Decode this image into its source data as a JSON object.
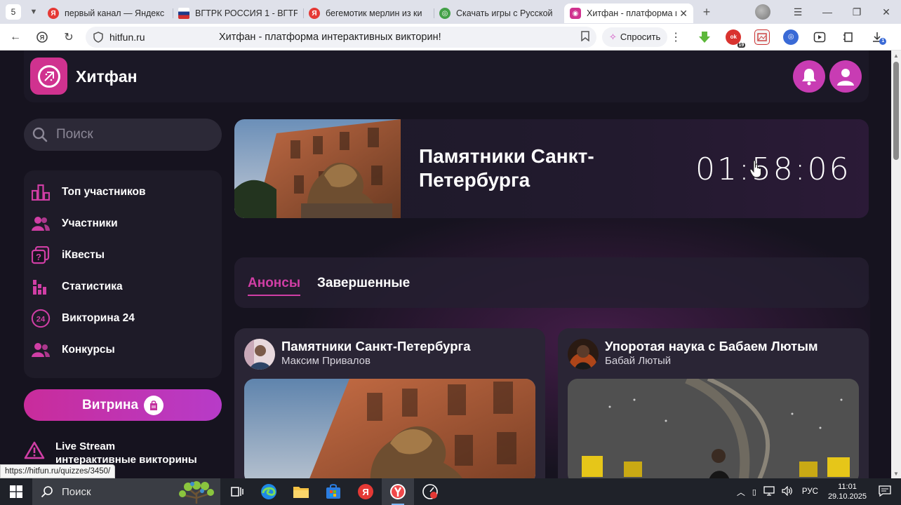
{
  "browser": {
    "tab_count": "5",
    "tabs": [
      {
        "title": "первый канал — Яндекс",
        "favicon": "yandex-icon",
        "color": "#e53935"
      },
      {
        "title": "ВГТРК РОССИЯ 1 - ВГТР",
        "favicon": "flag-icon",
        "color": "#1e3a8a"
      },
      {
        "title": "бегемотик мерлин из ки",
        "favicon": "yandex-icon",
        "color": "#e53935"
      },
      {
        "title": "Скачать игры с Русской",
        "favicon": "globe-icon",
        "color": "#43a047"
      },
      {
        "title": "Хитфан - платформа и",
        "favicon": "hitfun-icon",
        "color": "#d0328f"
      }
    ],
    "url": "hitfun.ru",
    "page_title": "Хитфан - платформа интерактивных викторин!",
    "ask_label": "Спросить",
    "status_url": "https://hitfun.ru/quizzes/3450/",
    "ext_badge": "19"
  },
  "site": {
    "logo_text": "Хитфан",
    "accent": "#d0328f",
    "search_placeholder": "Поиск",
    "nav": [
      {
        "label": "Топ участников",
        "icon": "bar-chart-icon"
      },
      {
        "label": "Участники",
        "icon": "users-icon"
      },
      {
        "label": "iКвесты",
        "icon": "quest-icon"
      },
      {
        "label": "Статистика",
        "icon": "stats-icon"
      },
      {
        "label": "Викторина 24",
        "icon": "quiz-24-icon",
        "badge": "24"
      },
      {
        "label": "Конкурсы",
        "icon": "contest-icon"
      }
    ],
    "vitrina_label": "Витрина",
    "live_title": "Live Stream",
    "live_subtitle": "интерактивные викторины"
  },
  "hero": {
    "title": "Памятники Санкт-Петербурга",
    "timer": "01:58:06"
  },
  "tabs": {
    "announcements": "Анонсы",
    "finished": "Завершенные"
  },
  "cards": [
    {
      "title": "Памятники Санкт-Петербурга",
      "author": "Максим Привалов"
    },
    {
      "title": "Упоротая наука с Бабаем Лютым",
      "author": "Бабай Лютый"
    }
  ],
  "taskbar": {
    "search_placeholder": "Поиск",
    "lang": "РУС",
    "time": "11:01",
    "date": "29.10.2025"
  }
}
